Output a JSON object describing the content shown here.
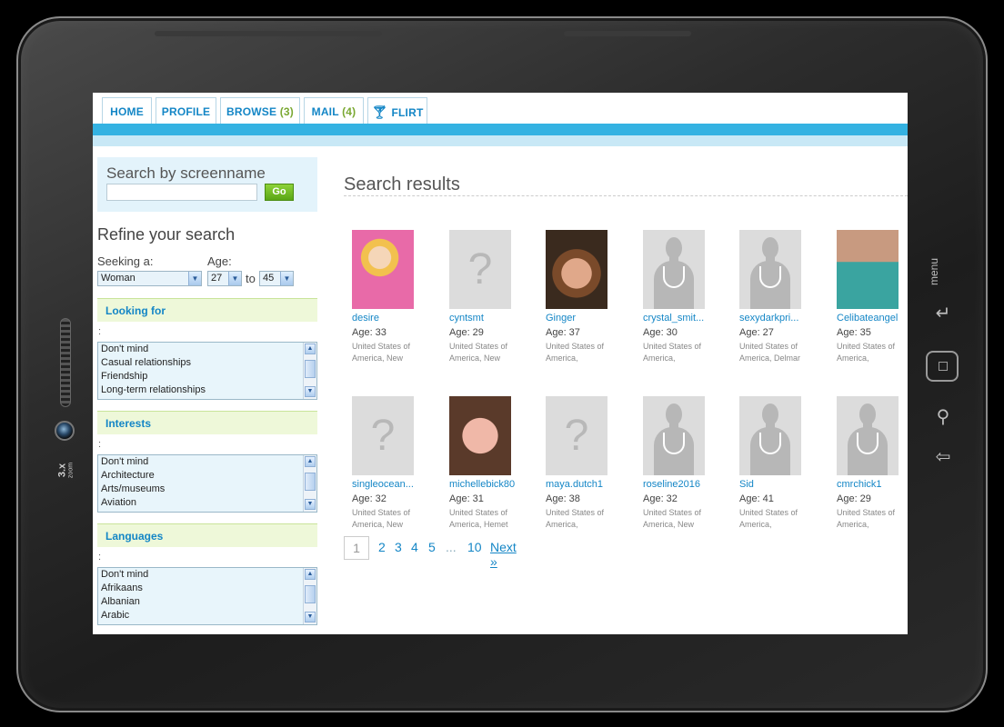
{
  "device": {
    "zoom_label": "3.x",
    "zoom_sub": "zoom",
    "menu_label": "menu"
  },
  "nav": {
    "tabs": [
      {
        "label": "HOME",
        "count": ""
      },
      {
        "label": "PROFILE",
        "count": ""
      },
      {
        "label": "BROWSE",
        "count": "(3)"
      },
      {
        "label": "MAIL",
        "count": "(4)"
      },
      {
        "label": "FLIRT",
        "count": ""
      }
    ]
  },
  "search": {
    "title": "Search by screenname",
    "input_value": "",
    "go_label": "Go"
  },
  "refine": {
    "title": "Refine your search",
    "seeking_label": "Seeking a:",
    "seeking_value": "Woman",
    "age_label": "Age:",
    "age_from": "27",
    "age_to_label": "to",
    "age_to": "45"
  },
  "sections": [
    {
      "title": "Looking for",
      "colon": ":",
      "options": [
        "Don't mind",
        "Casual relationships",
        "Friendship",
        "Long-term relationships"
      ]
    },
    {
      "title": "Interests",
      "colon": ":",
      "options": [
        "Don't mind",
        "Architecture",
        "Arts/museums",
        "Aviation"
      ]
    },
    {
      "title": "Languages",
      "colon": ":",
      "options": [
        "Don't mind",
        "Afrikaans",
        "Albanian",
        "Arabic"
      ]
    }
  ],
  "results": {
    "title": "Search results",
    "profiles": [
      {
        "name": "desire",
        "age": "Age: 33",
        "location": "United States of America, New",
        "photo": "real-pink"
      },
      {
        "name": "cyntsmt",
        "age": "Age: 29",
        "location": "United States of America, New",
        "photo": "unknown"
      },
      {
        "name": "Ginger",
        "age": "Age: 37",
        "location": "United States of America,",
        "photo": "real-woman"
      },
      {
        "name": "crystal_smit...",
        "age": "Age: 30",
        "location": "United States of America,",
        "photo": "silhouette"
      },
      {
        "name": "sexydarkpri...",
        "age": "Age: 27",
        "location": "United States of America, Delmar",
        "photo": "silhouette"
      },
      {
        "name": "Celibateangel",
        "age": "Age: 35",
        "location": "United States of America,",
        "photo": "real-man"
      },
      {
        "name": "singleocean...",
        "age": "Age: 32",
        "location": "United States of America, New",
        "photo": "unknown"
      },
      {
        "name": "michellebick80",
        "age": "Age: 31",
        "location": "United States of America, Hemet",
        "photo": "real-closeup"
      },
      {
        "name": "maya.dutch1",
        "age": "Age: 38",
        "location": "United States of America,",
        "photo": "unknown"
      },
      {
        "name": "roseline2016",
        "age": "Age: 32",
        "location": "United States of America, New",
        "photo": "silhouette"
      },
      {
        "name": "Sid",
        "age": "Age: 41",
        "location": "United States of America,",
        "photo": "silhouette"
      },
      {
        "name": "cmrchick1",
        "age": "Age: 29",
        "location": "United States of America,",
        "photo": "silhouette"
      }
    ]
  },
  "pager": {
    "current": "1",
    "pages": [
      "2",
      "3",
      "4",
      "5",
      "...",
      "10"
    ],
    "next_label": "Next »"
  }
}
